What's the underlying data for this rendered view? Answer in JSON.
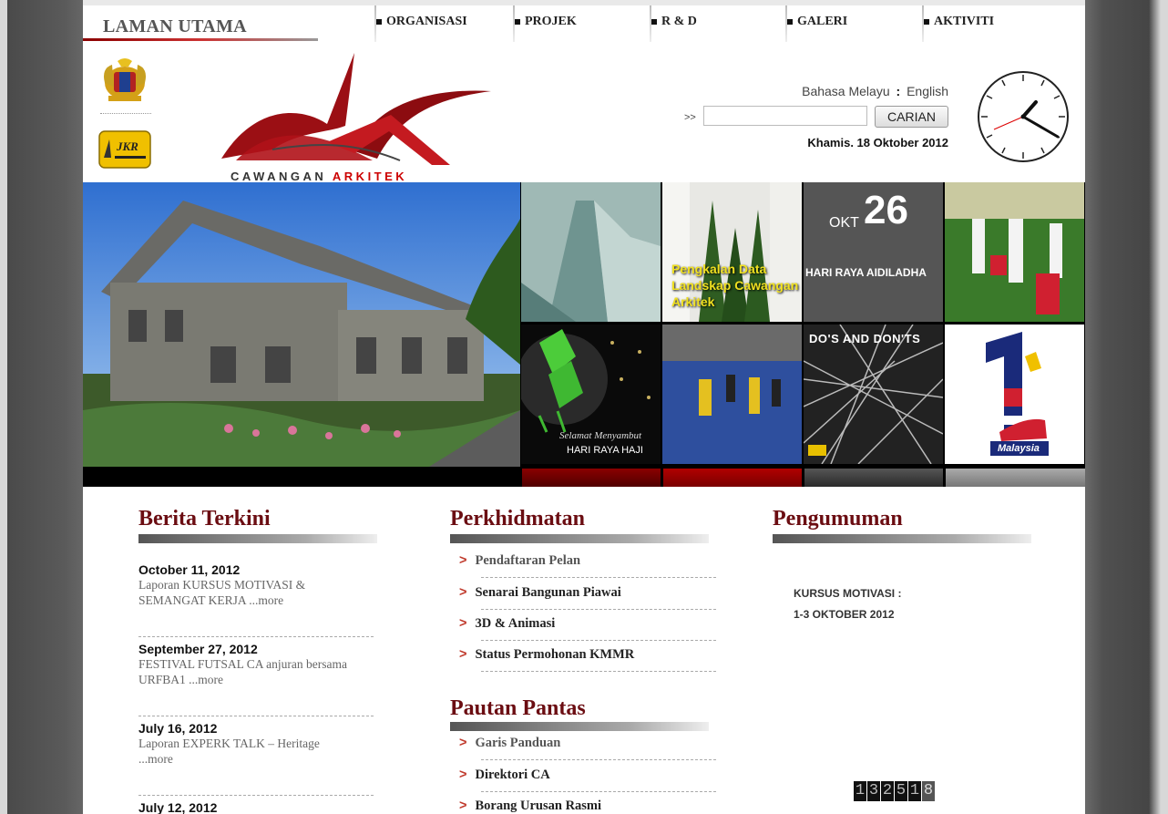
{
  "nav": {
    "home": "LAMAN UTAMA",
    "items": [
      {
        "label": "ORGANISASI"
      },
      {
        "label": "PROJEK"
      },
      {
        "label": "R & D"
      },
      {
        "label": "GALERI"
      },
      {
        "label": "AKTIVITI"
      }
    ]
  },
  "header": {
    "logo_text_part1": "CAWANGAN ",
    "logo_text_part2": "ARKITEK",
    "jkr_text": "JKR",
    "lang_malay": "Bahasa Melayu",
    "lang_sep": ":",
    "lang_english": "English",
    "search_prompt": ">>",
    "search_value": "",
    "search_button": "CARIAN",
    "date": "Khamis. 18 Oktober 2012"
  },
  "banner": {
    "tiles": [
      {
        "caption": "Pengkalan Data Landskap Cawangan Arkitek"
      },
      {
        "month": "OKT",
        "day": "26",
        "caption": "HARI RAYA AIDILADHA"
      },
      {
        "caption_script": "Selamat Menyambut",
        "caption": "HARI RAYA HAJI"
      },
      {
        "caption": "DO'S AND DON'TS"
      },
      {
        "caption": "Malaysia"
      }
    ]
  },
  "news": {
    "title": "Berita Terkini",
    "items": [
      {
        "date": "October 11, 2012",
        "text": "Laporan KURSUS MOTIVASI & SEMANGAT KERJA ...more"
      },
      {
        "date": "September 27, 2012",
        "text": "FESTIVAL FUTSAL CA anjuran bersama URFBA1 ...more"
      },
      {
        "date": "July 16, 2012",
        "text": "Laporan EXPERK TALK – Heritage ...more"
      },
      {
        "date": "July 12, 2012",
        "text": ""
      }
    ]
  },
  "services": {
    "title": "Perkhidmatan",
    "items": [
      {
        "label": "Pendaftaran Pelan"
      },
      {
        "label": "Senarai Bangunan Piawai"
      },
      {
        "label": "3D & Animasi"
      },
      {
        "label": "Status Permohonan KMMR"
      }
    ]
  },
  "quicklinks": {
    "title": "Pautan Pantas",
    "items": [
      {
        "label": "Garis Panduan"
      },
      {
        "label": "Direktori CA"
      },
      {
        "label": "Borang Urusan Rasmi"
      }
    ]
  },
  "announcements": {
    "title": "Pengumuman",
    "line1": "KURSUS MOTIVASI :",
    "line2": "1-3 OKTOBER 2012"
  },
  "counter": {
    "value": "132518"
  },
  "colors": {
    "accent": "#6b0d12",
    "brand_red": "#c00000",
    "arrow": "#c0392b"
  }
}
